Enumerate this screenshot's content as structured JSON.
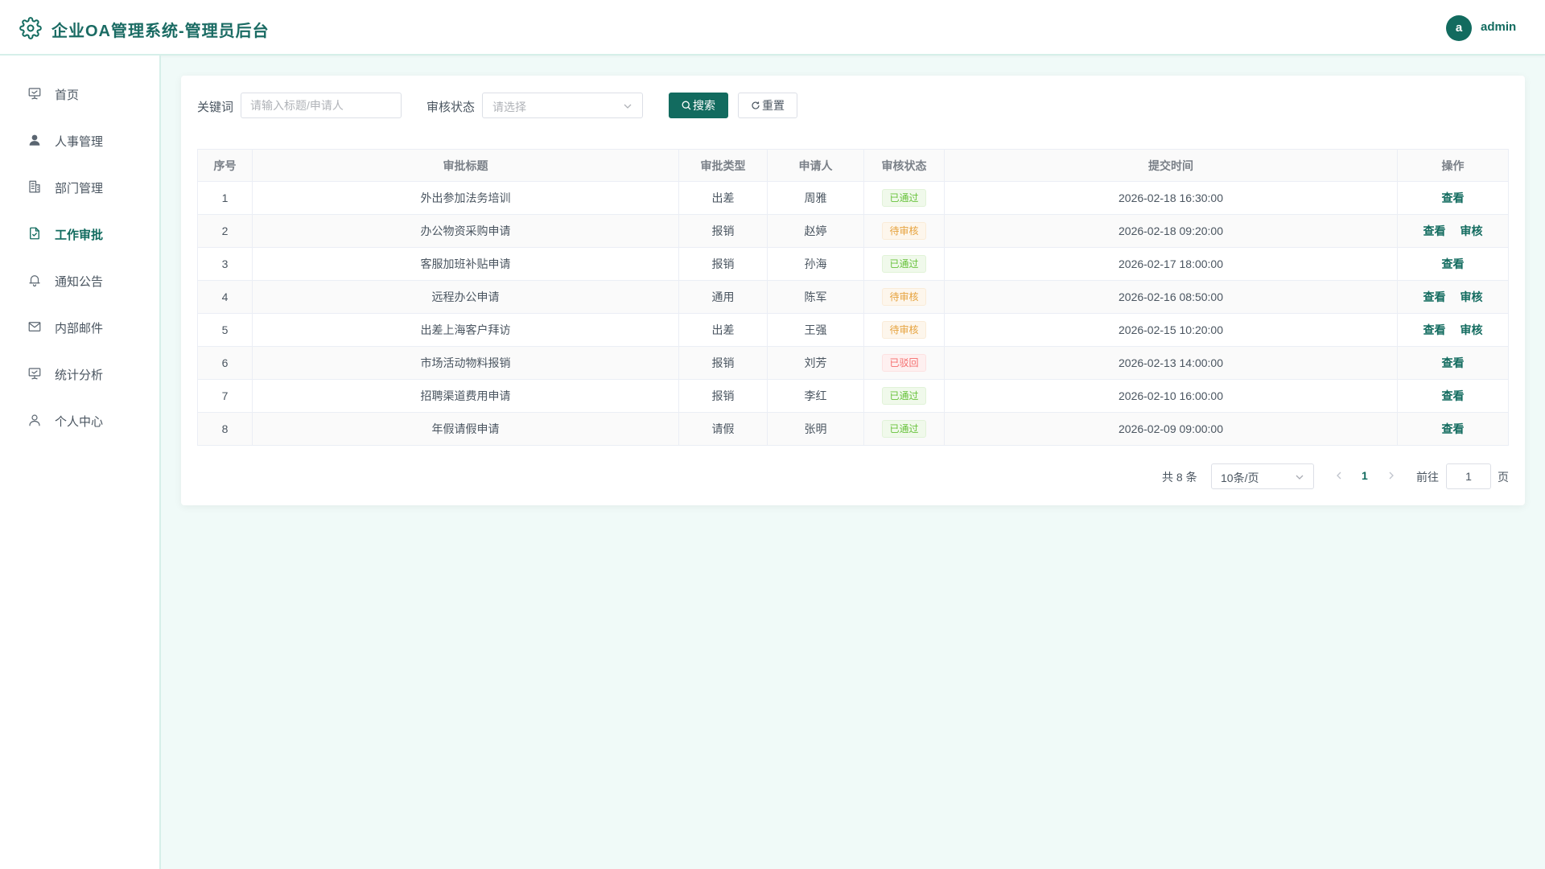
{
  "header": {
    "title": "企业OA管理系统-管理员后台",
    "avatar_letter": "a",
    "username": "admin",
    "logo_icon": "gear-icon"
  },
  "sidebar": {
    "items": [
      {
        "label": "首页",
        "icon": "presentation-icon"
      },
      {
        "label": "人事管理",
        "icon": "user-icon"
      },
      {
        "label": "部门管理",
        "icon": "building-icon"
      },
      {
        "label": "工作审批",
        "icon": "document-check-icon",
        "active": true
      },
      {
        "label": "通知公告",
        "icon": "bell-icon"
      },
      {
        "label": "内部邮件",
        "icon": "mail-icon"
      },
      {
        "label": "统计分析",
        "icon": "chart-board-icon"
      },
      {
        "label": "个人中心",
        "icon": "user-outline-icon"
      }
    ]
  },
  "filters": {
    "keyword_label": "关键词",
    "keyword_placeholder": "请输入标题/申请人",
    "keyword_value": "",
    "status_label": "审核状态",
    "status_placeholder": "请选择",
    "search_button": "搜索",
    "reset_button": "重置"
  },
  "table": {
    "columns": [
      "序号",
      "审批标题",
      "审批类型",
      "申请人",
      "审核状态",
      "提交时间",
      "操作"
    ],
    "rows": [
      {
        "no": "1",
        "title": "外出参加法务培训",
        "type": "出差",
        "applicant": "周雅",
        "status": "已通过",
        "status_kind": "pass",
        "time": "2026-02-18 16:30:00",
        "actions": [
          "查看"
        ]
      },
      {
        "no": "2",
        "title": "办公物资采购申请",
        "type": "报销",
        "applicant": "赵婷",
        "status": "待审核",
        "status_kind": "pending",
        "time": "2026-02-18 09:20:00",
        "actions": [
          "查看",
          "审核"
        ]
      },
      {
        "no": "3",
        "title": "客服加班补贴申请",
        "type": "报销",
        "applicant": "孙海",
        "status": "已通过",
        "status_kind": "pass",
        "time": "2026-02-17 18:00:00",
        "actions": [
          "查看"
        ]
      },
      {
        "no": "4",
        "title": "远程办公申请",
        "type": "通用",
        "applicant": "陈军",
        "status": "待审核",
        "status_kind": "pending",
        "time": "2026-02-16 08:50:00",
        "actions": [
          "查看",
          "审核"
        ]
      },
      {
        "no": "5",
        "title": "出差上海客户拜访",
        "type": "出差",
        "applicant": "王强",
        "status": "待审核",
        "status_kind": "pending",
        "time": "2026-02-15 10:20:00",
        "actions": [
          "查看",
          "审核"
        ]
      },
      {
        "no": "6",
        "title": "市场活动物料报销",
        "type": "报销",
        "applicant": "刘芳",
        "status": "已驳回",
        "status_kind": "reject",
        "time": "2026-02-13 14:00:00",
        "actions": [
          "查看"
        ]
      },
      {
        "no": "7",
        "title": "招聘渠道费用申请",
        "type": "报销",
        "applicant": "李红",
        "status": "已通过",
        "status_kind": "pass",
        "time": "2026-02-10 16:00:00",
        "actions": [
          "查看"
        ]
      },
      {
        "no": "8",
        "title": "年假请假申请",
        "type": "请假",
        "applicant": "张明",
        "status": "已通过",
        "status_kind": "pass",
        "time": "2026-02-09 09:00:00",
        "actions": [
          "查看"
        ]
      }
    ]
  },
  "pagination": {
    "total_text": "共 8 条",
    "page_size": "10条/页",
    "current_page": "1",
    "goto_label": "前往",
    "goto_value": "1",
    "page_suffix": "页"
  },
  "colors": {
    "brand": "#126b5f",
    "pass": "#67c23a",
    "pending": "#e6a23c",
    "reject": "#f56c6c"
  }
}
